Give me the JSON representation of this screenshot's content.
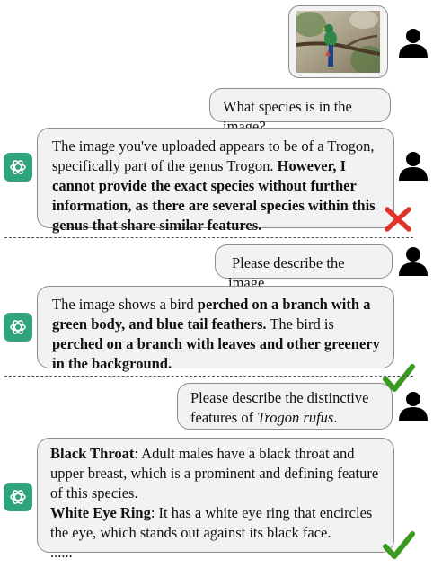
{
  "conversation": {
    "image_message": {
      "image_subject": "Trogon bird perched on a branch"
    },
    "turn1": {
      "user": "What species is in the image?",
      "assistant": {
        "p1": "The image you've uploaded appears to be of a Trogon, specifically part of the genus Trogon. ",
        "p2_bold": "However, I cannot provide the exact species without further information, as there are several species within this genus that share similar features."
      },
      "verdict": "incorrect"
    },
    "turn2": {
      "user": "Please describe the image.",
      "assistant": {
        "p1": "The image shows a bird ",
        "p2_bold": "perched on a branch with a green body, and blue tail feathers.",
        "p3": " The bird is ",
        "p4_bold": "perched on a branch with leaves and other greenery in the background."
      },
      "verdict": "correct"
    },
    "turn3": {
      "user": {
        "p1": "Please describe the distinctive features of ",
        "p2_italic": "Trogon rufus",
        "p3": "."
      },
      "assistant": {
        "item1_title": "Black Throat",
        "item1_text": ": Adult males have a black throat and upper breast, which is a prominent and defining feature of this species.",
        "item2_title": "White Eye Ring",
        "item2_text": ": It has a white eye ring that encircles the eye, which stands out against its black face.",
        "ellipsis": "......"
      },
      "verdict": "correct"
    }
  },
  "colors": {
    "bubble_bg": "#f2f2f2",
    "bubble_border": "#8c8c8c",
    "assistant_icon_bg": "#2fa37c",
    "check_green": "#3a9a1e",
    "cross_red": "#e0332a"
  },
  "icons": {
    "user": "person-silhouette-icon",
    "assistant": "openai-logo-icon",
    "correct": "check-mark-icon",
    "incorrect": "x-mark-icon"
  }
}
